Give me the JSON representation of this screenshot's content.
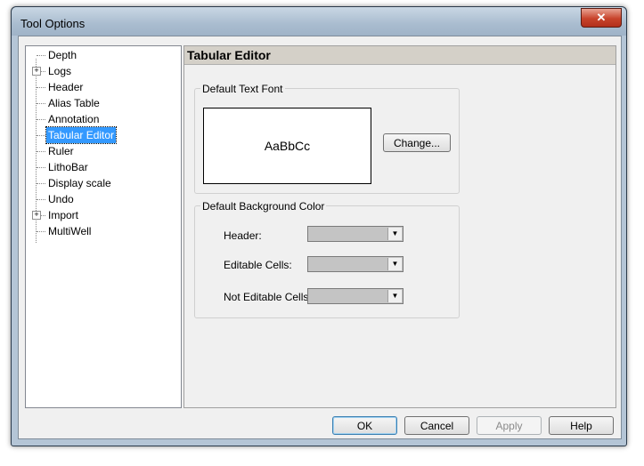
{
  "window": {
    "title": "Tool Options",
    "close_glyph": "✕"
  },
  "tree": {
    "items": [
      {
        "label": "Depth",
        "expandable": false
      },
      {
        "label": "Logs",
        "expandable": true
      },
      {
        "label": "Header",
        "expandable": false
      },
      {
        "label": "Alias Table",
        "expandable": false
      },
      {
        "label": "Annotation",
        "expandable": false
      },
      {
        "label": "Tabular Editor",
        "expandable": false,
        "selected": true
      },
      {
        "label": "Ruler",
        "expandable": false
      },
      {
        "label": "LithoBar",
        "expandable": false
      },
      {
        "label": "Display scale",
        "expandable": false
      },
      {
        "label": "Undo",
        "expandable": false
      },
      {
        "label": "Import",
        "expandable": true
      },
      {
        "label": "MultiWell",
        "expandable": false
      }
    ],
    "expander_glyph": "+"
  },
  "panel": {
    "title": "Tabular Editor",
    "font_group": {
      "title": "Default Text Font",
      "preview_text": "AaBbCc",
      "change_button": "Change..."
    },
    "bg_group": {
      "title": "Default Background Color",
      "rows": [
        {
          "label": "Header:",
          "value_color": "#c4c4c4"
        },
        {
          "label": "Editable Cells:",
          "value_color": "#c4c4c4"
        },
        {
          "label": "Not Editable Cells:",
          "value_color": "#c4c4c4"
        }
      ],
      "dropdown_glyph": "▼"
    }
  },
  "footer": {
    "ok": "OK",
    "cancel": "Cancel",
    "apply": "Apply",
    "help": "Help"
  }
}
